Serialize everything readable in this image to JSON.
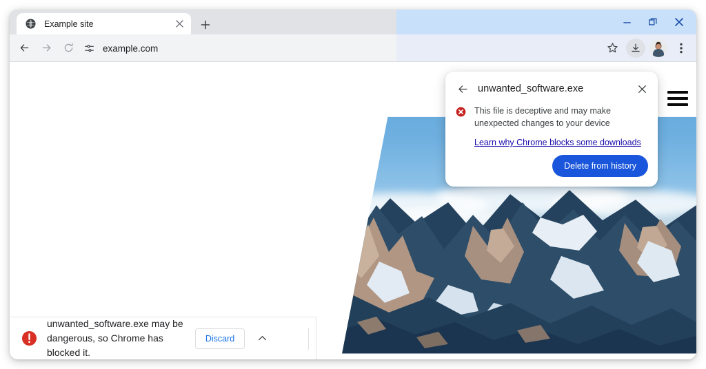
{
  "window": {
    "controls": [
      {
        "name": "minimize",
        "glyph": "minimize-icon"
      },
      {
        "name": "maximize",
        "glyph": "restore-icon"
      },
      {
        "name": "close",
        "glyph": "close-icon"
      }
    ]
  },
  "tabstrip": {
    "tabs": [
      {
        "title": "Example site",
        "favicon": "globe-icon",
        "close_label": "close-icon"
      }
    ],
    "new_tab_label": "plus-icon"
  },
  "toolbar": {
    "back_icon": "arrow-left-icon",
    "forward_icon": "arrow-right-icon",
    "reload_icon": "reload-icon",
    "site_settings_icon": "tune-icon",
    "url": "example.com",
    "bookmark_icon": "star-icon",
    "download_icon": "download-icon",
    "avatar_icon": "profile-avatar",
    "menu_icon": "three-dot-menu-icon"
  },
  "page": {
    "hamburger_icon": "hamburger-menu-icon",
    "hero_alt": "snow-capped-mountain-range"
  },
  "download_shelf": {
    "alert_icon": "error-circle-icon",
    "message": "unwanted_software.exe may be dangerous, so Chrome has blocked it.",
    "discard_label": "Discard",
    "expand_icon": "chevron-up-icon"
  },
  "download_bubble": {
    "back_icon": "arrow-left-icon",
    "title": "unwanted_software.exe",
    "close_icon": "close-icon",
    "error_icon": "error-x-circle-icon",
    "warning": "This file is deceptive and may make unexpected changes to your device",
    "link_text": "Learn why Chrome blocks some downloads",
    "primary_button_label": "Delete from history"
  },
  "colors": {
    "accent_blue": "#1a56db",
    "link_blue": "#1a0dab",
    "discard_blue": "#1a73e8",
    "error_red": "#c5221f",
    "shelf_alert_red": "#d93025",
    "chrome_grey": "#f1f3f4",
    "focus_blue": "#c9e0fb"
  }
}
